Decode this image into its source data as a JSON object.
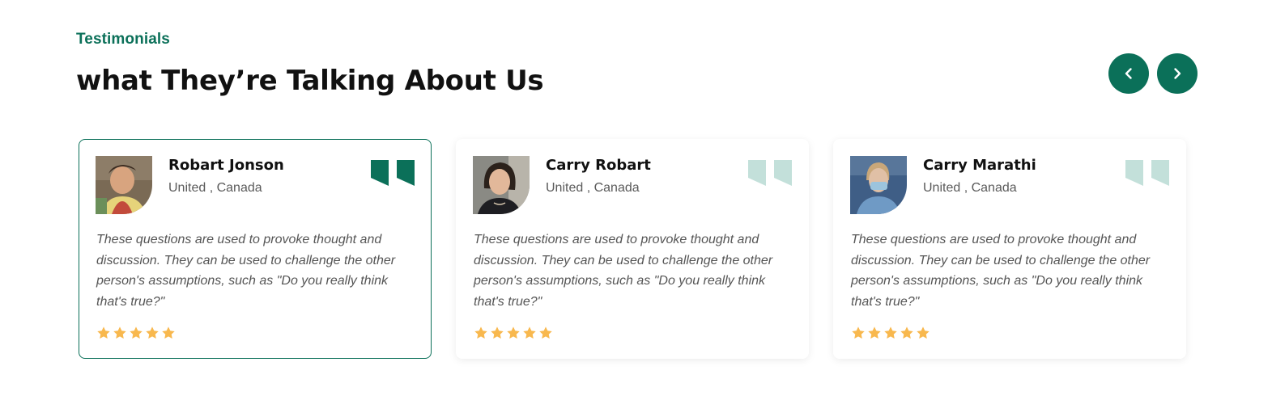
{
  "section": {
    "eyebrow": "Testimonials",
    "heading": "what They’re Talking About Us"
  },
  "navigation": {
    "prev_icon": "chevron-left-icon",
    "next_icon": "chevron-right-icon"
  },
  "colors": {
    "brand": "#0b7059",
    "quote_active": "#0b7059",
    "quote_inactive": "#c3e0da",
    "star": "#f8b84e"
  },
  "testimonials": [
    {
      "name": "Robart Jonson",
      "location": "United , Canada",
      "text": "These questions are used to provoke thought and discussion. They can be used to challenge the other person's assumptions, such as \"Do you really think that's true?\"",
      "rating": 5,
      "active": true
    },
    {
      "name": "Carry Robart",
      "location": "United , Canada",
      "text": "These questions are used to provoke thought and discussion. They can be used to challenge the other person's assumptions, such as \"Do you really think that's true?\"",
      "rating": 5,
      "active": false
    },
    {
      "name": "Carry Marathi",
      "location": "United , Canada",
      "text": "These questions are used to provoke thought and discussion. They can be used to challenge the other person's assumptions, such as \"Do you really think that's true?\"",
      "rating": 5,
      "active": false
    }
  ]
}
